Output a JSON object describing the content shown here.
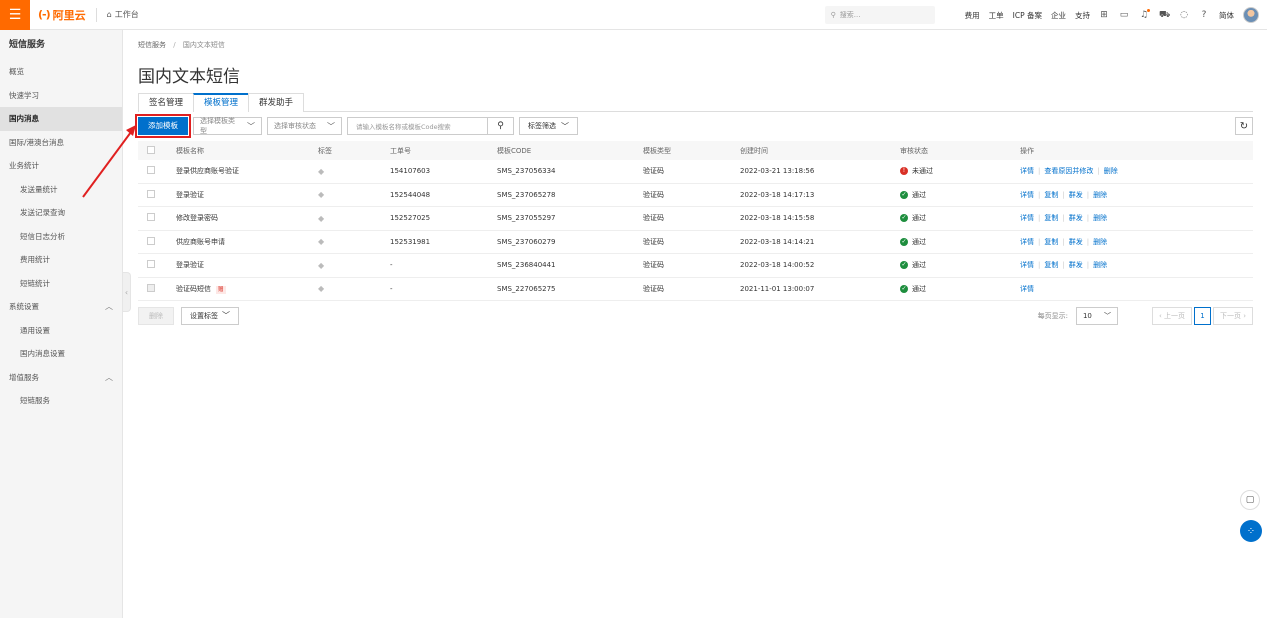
{
  "topbar": {
    "logo_mark": "(-)",
    "logo_text": "阿里云",
    "workbench": "工作台",
    "search_placeholder": "搜索...",
    "links": [
      "费用",
      "工单",
      "ICP 备案",
      "企业",
      "支持"
    ],
    "lang": "简体"
  },
  "sidebar": {
    "title": "短信服务",
    "items": [
      {
        "label": "概览"
      },
      {
        "label": "快速学习"
      },
      {
        "label": "国内消息"
      },
      {
        "label": "国际/港澳台消息"
      },
      {
        "label": "业务统计"
      },
      {
        "label": "发送量统计"
      },
      {
        "label": "发送记录查询"
      },
      {
        "label": "短信日志分析"
      },
      {
        "label": "费用统计"
      },
      {
        "label": "短链统计"
      },
      {
        "label": "系统设置"
      },
      {
        "label": "通用设置"
      },
      {
        "label": "国内消息设置"
      },
      {
        "label": "增值服务"
      },
      {
        "label": "短链服务"
      }
    ]
  },
  "breadcrumb": {
    "root": "短信服务",
    "sep": "/",
    "current": "国内文本短信"
  },
  "page_title": "国内文本短信",
  "tabs": [
    {
      "label": "签名管理"
    },
    {
      "label": "模板管理"
    },
    {
      "label": "群发助手"
    }
  ],
  "toolbar": {
    "add_label": "添加模板",
    "type_placeholder": "选择模板类型",
    "status_placeholder": "选择审核状态",
    "search_placeholder": "请输入模板名称或模板Code搜索",
    "tag_filter": "标签筛选"
  },
  "table": {
    "headers": {
      "name": "模板名称",
      "tag": "标签",
      "ticket": "工单号",
      "code": "模板CODE",
      "type": "模板类型",
      "time": "创建时间",
      "status": "审核状态",
      "ops": "操作"
    },
    "rows": [
      {
        "name": "登录供应商账号验证",
        "badge": "",
        "ticket": "154107603",
        "code": "SMS_237056334",
        "type": "验证码",
        "time": "2022-03-21 13:18:56",
        "status": "未通过",
        "op1": "详情",
        "op2": "查看原因并修改",
        "op3": "删除"
      },
      {
        "name": "登录验证",
        "badge": "",
        "ticket": "152544048",
        "code": "SMS_237065278",
        "type": "验证码",
        "time": "2022-03-18 14:17:13",
        "status": "通过",
        "op1": "详情",
        "op2": "复制",
        "op3": "群发",
        "op4": "删除"
      },
      {
        "name": "修改登录密码",
        "badge": "",
        "ticket": "152527025",
        "code": "SMS_237055297",
        "type": "验证码",
        "time": "2022-03-18 14:15:58",
        "status": "通过",
        "op1": "详情",
        "op2": "复制",
        "op3": "群发",
        "op4": "删除"
      },
      {
        "name": "供应商账号申请",
        "badge": "",
        "ticket": "152531981",
        "code": "SMS_237060279",
        "type": "验证码",
        "time": "2022-03-18 14:14:21",
        "status": "通过",
        "op1": "详情",
        "op2": "复制",
        "op3": "群发",
        "op4": "删除"
      },
      {
        "name": "登录验证",
        "badge": "",
        "ticket": "-",
        "code": "SMS_236840441",
        "type": "验证码",
        "time": "2022-03-18 14:00:52",
        "status": "通过",
        "op1": "详情",
        "op2": "复制",
        "op3": "群发",
        "op4": "删除"
      },
      {
        "name": "验证码短信",
        "badge": "赠",
        "ticket": "-",
        "code": "SMS_227065275",
        "type": "验证码",
        "time": "2021-11-01 13:00:07",
        "status": "通过",
        "op1": "详情"
      }
    ]
  },
  "footer": {
    "delete_label": "删除",
    "set_tag_label": "设置标签",
    "page_size_label": "每页显示:",
    "page_size": "10",
    "prev": "上一页",
    "page": "1",
    "next": "下一页"
  },
  "colors": {
    "brand": "#ff6a00",
    "primary": "#0070cc",
    "fail": "#d93026",
    "pass": "#1e8e3e",
    "annotation": "#e02020"
  }
}
